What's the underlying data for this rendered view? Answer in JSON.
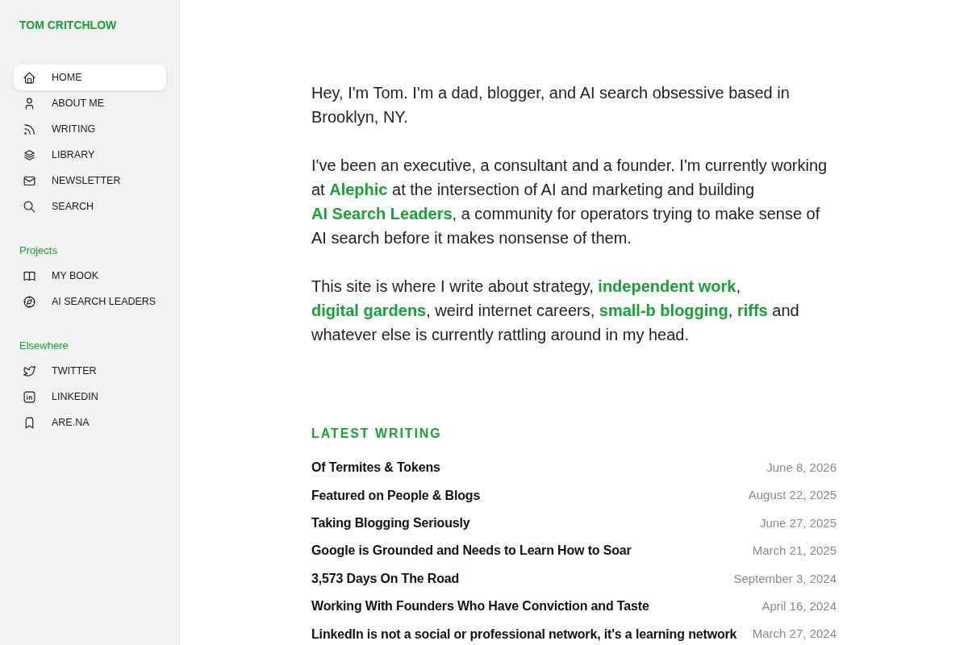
{
  "sidebar": {
    "site_title": "TOM CRITCHLOW",
    "nav": [
      {
        "label": "HOME",
        "selected": true
      },
      {
        "label": "ABOUT ME",
        "selected": false
      },
      {
        "label": "WRITING",
        "selected": false
      },
      {
        "label": "LIBRARY",
        "selected": false
      },
      {
        "label": "NEWSLETTER",
        "selected": false
      },
      {
        "label": "SEARCH",
        "selected": false
      }
    ],
    "sections": [
      {
        "heading": "Projects",
        "items": [
          {
            "label": "MY BOOK",
            "selected": false
          },
          {
            "label": "AI SEARCH LEADERS",
            "selected": false
          }
        ]
      },
      {
        "heading": "Elsewhere",
        "items": [
          {
            "label": "TWITTER",
            "selected": false
          },
          {
            "label": "LINKEDIN",
            "selected": false
          },
          {
            "label": "ARE.NA",
            "selected": false
          }
        ]
      }
    ]
  },
  "intro": {
    "paragraphs": [
      [
        {
          "kind": "text",
          "text": "Hey, I'm Tom. I'm a dad, blogger, and AI search obsessive based in Brooklyn, NY."
        }
      ],
      [
        {
          "kind": "text",
          "text": "I've been an executive, a consultant and a founder. I'm currently working at "
        },
        {
          "kind": "link",
          "text": "Alephic"
        },
        {
          "kind": "text",
          "text": " at the intersection of AI and marketing and building "
        },
        {
          "kind": "link",
          "text": "AI Search Leaders"
        },
        {
          "kind": "text",
          "text": ", a community for operators trying to make sense of AI search before it makes nonsense of them."
        }
      ],
      [
        {
          "kind": "text",
          "text": "This site is where I write about strategy, "
        },
        {
          "kind": "link",
          "text": "independent work"
        },
        {
          "kind": "text",
          "text": ", "
        },
        {
          "kind": "link",
          "text": "digital gardens"
        },
        {
          "kind": "text",
          "text": ", weird internet careers, "
        },
        {
          "kind": "link",
          "text": "small-b blogging"
        },
        {
          "kind": "text",
          "text": ", "
        },
        {
          "kind": "link",
          "text": "riffs"
        },
        {
          "kind": "text",
          "text": " and whatever else is currently rattling around in my head."
        }
      ]
    ]
  },
  "latest_writing": {
    "heading": "LATEST WRITING",
    "posts": [
      {
        "title": "Of Termites & Tokens",
        "date": "June 8, 2026"
      },
      {
        "title": "Featured on People & Blogs",
        "date": "August 22, 2025"
      },
      {
        "title": "Taking Blogging Seriously",
        "date": "June 27, 2025"
      },
      {
        "title": "Google is Grounded and Needs to Learn How to Soar",
        "date": "March 21, 2025"
      },
      {
        "title": "3,573 Days On The Road",
        "date": "September 3, 2024"
      },
      {
        "title": "Working With Founders Who Have Conviction and Taste",
        "date": "April 16, 2024"
      },
      {
        "title": "LinkedIn is not a social or professional network, it's a learning network",
        "date": "March 27, 2024"
      }
    ]
  }
}
